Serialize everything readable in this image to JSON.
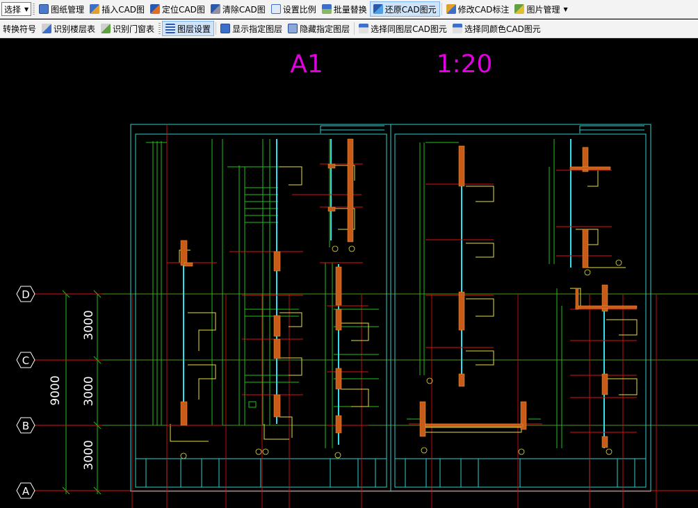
{
  "toolbar1": {
    "select_label": "选择",
    "items": [
      "图纸管理",
      "插入CAD图",
      "定位CAD图",
      "清除CAD图",
      "设置比例",
      "批量替换",
      "还原CAD图元",
      "修改CAD标注",
      "图片管理"
    ]
  },
  "toolbar2": {
    "items": [
      "转换符号",
      "识别楼层表",
      "识别门窗表",
      "图层设置",
      "显示指定图层",
      "隐藏指定图层",
      "选择同图层CAD图元",
      "选择同颜色CAD图元"
    ]
  },
  "drawing": {
    "sheet_label": "A1",
    "scale_label": "1:20",
    "axis_labels": [
      "D",
      "C",
      "B",
      "A"
    ],
    "dimensions": [
      "3000",
      "3000",
      "3000"
    ],
    "total_dimension": "9000"
  },
  "colors": {
    "background": "#000000",
    "title_magenta": "#e000e0",
    "grid_red": "#e01010",
    "dim_green": "#20c020",
    "frame_cyan": "#30d0d0",
    "wall_yellow": "#e8e040",
    "glass_cyan": "#30e0f0",
    "axis_white": "#ffffff"
  }
}
